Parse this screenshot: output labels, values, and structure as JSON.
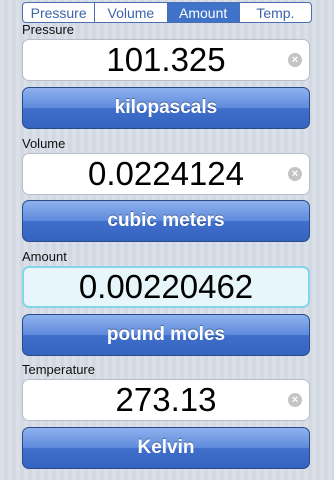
{
  "tabs": [
    "Pressure",
    "Volume",
    "Amount",
    "Temp."
  ],
  "active_tab": 2,
  "sections": [
    {
      "label": "Pressure",
      "value": "101.325",
      "unit": "kilopascals"
    },
    {
      "label": "Volume",
      "value": "0.0224124",
      "unit": "cubic meters"
    },
    {
      "label": "Amount",
      "value": "0.00220462",
      "unit": "pound moles"
    },
    {
      "label": "Temperature",
      "value": "273.13",
      "unit": "Kelvin"
    }
  ],
  "clear_glyph": "×",
  "colors": {
    "accent": "#3f72c9",
    "focus_border": "#86d4ea",
    "focus_bg": "#e6f6fb"
  },
  "icons": {
    "clear": "clear-x-icon"
  }
}
